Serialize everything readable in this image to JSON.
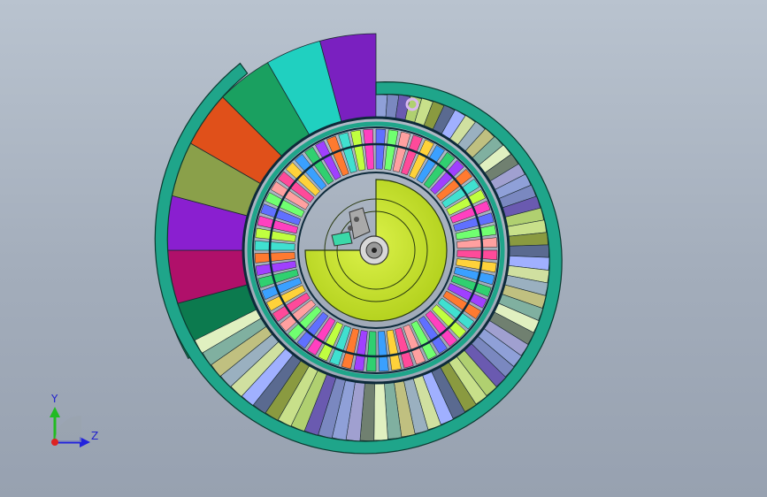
{
  "viewport": {
    "background_top": "#b9c3cf",
    "background_bottom": "#97a1b0"
  },
  "model": {
    "outer_ring_color": "#1fa58a",
    "hub_color": "#c8e62a",
    "outer_blade_colors": [
      "#0c7a4e",
      "#b0106a",
      "#8a1fd0",
      "#8aa04a",
      "#e0501a",
      "#1aa060",
      "#20d0c0",
      "#7a20c0"
    ],
    "inner_blade_colors": [
      "#ff4a9a",
      "#ffd23a",
      "#3aa0ff",
      "#30d070",
      "#a040ff",
      "#ff7a30",
      "#40e0d0",
      "#c0ff40",
      "#ff40c0",
      "#6070ff",
      "#70ff70",
      "#ffa0a0"
    ]
  },
  "triad": {
    "y_label": "Y",
    "z_label": "Z",
    "y_color": "#22bb22",
    "z_color": "#2222dd",
    "x_color": "#dd2222"
  }
}
